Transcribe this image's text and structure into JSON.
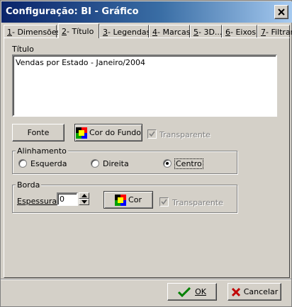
{
  "window": {
    "title": "Configuração: BI - Gráfico"
  },
  "tabs": [
    {
      "key": "1",
      "label": "- Dimensões"
    },
    {
      "key": "2",
      "label": "- Título"
    },
    {
      "key": "3",
      "label": "- Legendas"
    },
    {
      "key": "4",
      "label": "- Marcas"
    },
    {
      "key": "5",
      "label": "- 3D..."
    },
    {
      "key": "6",
      "label": "- Eixos"
    },
    {
      "key": "7",
      "label": "- Filtrar"
    }
  ],
  "titulo": {
    "label": "Título",
    "value": "Vendas por Estado - Janeiro/2004"
  },
  "buttons": {
    "fonte": "Fonte",
    "cor_do_fundo": "Cor do Fundo",
    "transparente": "Transparente"
  },
  "alinhamento": {
    "label": "Alinhamento",
    "options": [
      "Esquerda",
      "Direita",
      "Centro"
    ],
    "selected": "Centro"
  },
  "borda": {
    "label": "Borda",
    "espessura_label": "Espessura",
    "espessura_value": "0",
    "cor": "Cor",
    "transparente": "Transparente"
  },
  "footer": {
    "ok": "OK",
    "cancelar": "Cancelar"
  }
}
